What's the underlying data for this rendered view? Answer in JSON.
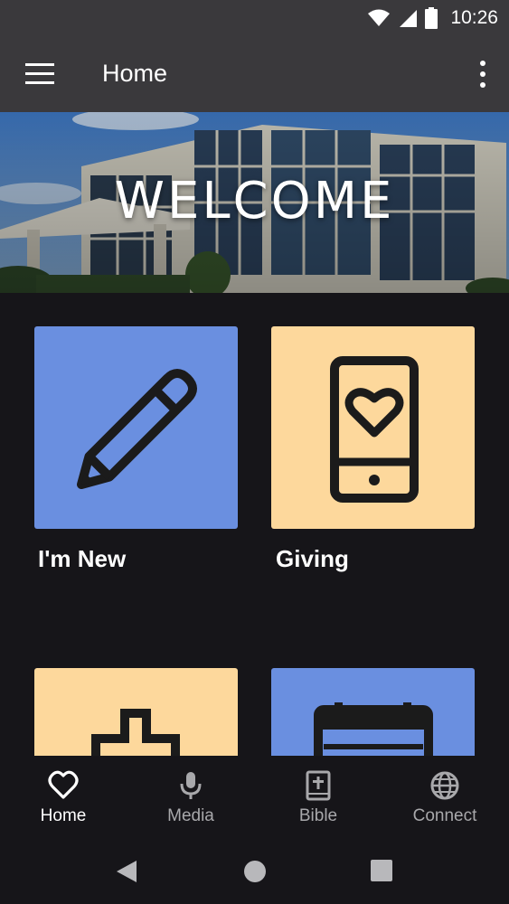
{
  "status_bar": {
    "time": "10:26"
  },
  "app_bar": {
    "title": "Home"
  },
  "hero": {
    "text": "WELCOME"
  },
  "tiles": [
    {
      "label": "I'm New",
      "color": "#6a8fe0",
      "icon": "pencil-icon"
    },
    {
      "label": "Giving",
      "color": "#fdd89c",
      "icon": "phone-heart-icon"
    },
    {
      "label": "",
      "color": "#fdd89c",
      "icon": "church-icon"
    },
    {
      "label": "",
      "color": "#6a8fe0",
      "icon": "calendar-icon"
    }
  ],
  "bottom_nav": {
    "items": [
      {
        "label": "Home",
        "icon": "heart-icon",
        "active": true
      },
      {
        "label": "Media",
        "icon": "microphone-icon",
        "active": false
      },
      {
        "label": "Bible",
        "icon": "bible-icon",
        "active": false
      },
      {
        "label": "Connect",
        "icon": "globe-icon",
        "active": false
      }
    ]
  },
  "colors": {
    "background": "#161519",
    "bar": "#3a393c",
    "blue_tile": "#6a8fe0",
    "yellow_tile": "#fdd89c",
    "inactive": "#a8a8ab"
  }
}
